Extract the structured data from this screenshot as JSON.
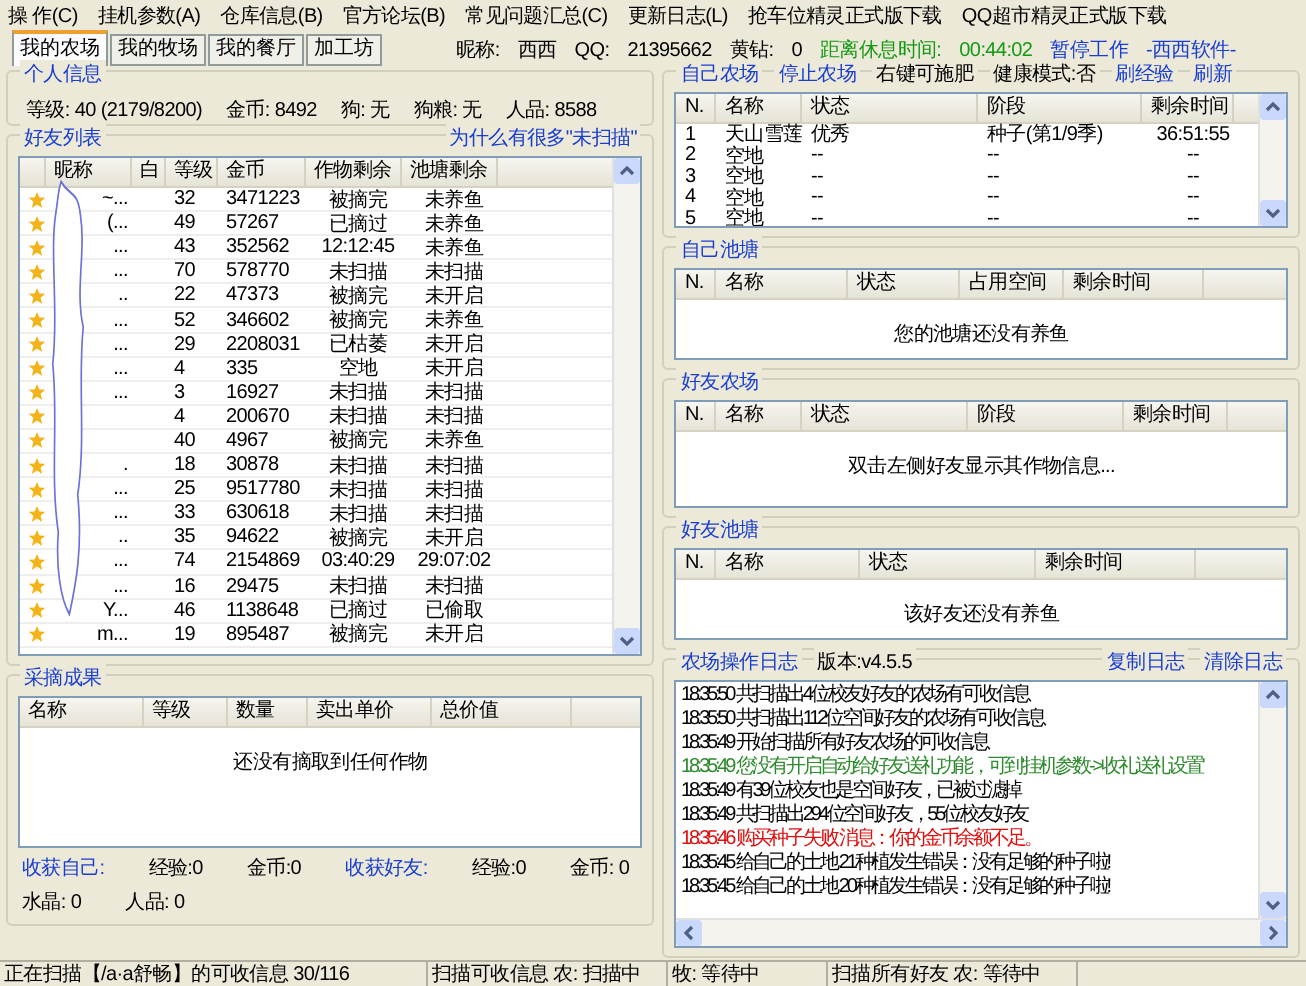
{
  "menu": [
    "操 作(C)",
    "挂机参数(A)",
    "仓库信息(B)",
    "官方论坛(B)",
    "常见问题汇总(C)",
    "更新日志(L)",
    "抢车位精灵正式版下载",
    "QQ超市精灵正式版下载"
  ],
  "tabs": [
    {
      "label": "我的农场",
      "selected": true
    },
    {
      "label": "我的牧场",
      "selected": false
    },
    {
      "label": "我的餐厅",
      "selected": false
    },
    {
      "label": "加工坊",
      "selected": false
    }
  ],
  "header": {
    "nickname_label": "昵称:",
    "nickname": "西西",
    "qq_label": "QQ:",
    "qq": "21395662",
    "diamond_label": "黄钻:",
    "diamond": "0",
    "rest_label": "距离休息时间:",
    "rest_time": "00:44:02",
    "pause": "暂停工作",
    "brand": "-西西软件-"
  },
  "personal": {
    "title": "个人信息",
    "fields": [
      {
        "label": "等级:",
        "value": "40 (2179/8200)"
      },
      {
        "label": "金币:",
        "value": "8492"
      },
      {
        "label": "狗:",
        "value": "无"
      },
      {
        "label": "狗粮:",
        "value": "无"
      },
      {
        "label": "人品:",
        "value": "8588"
      }
    ]
  },
  "friends": {
    "title": "好友列表",
    "link": "为什么有很多\"未扫描\"",
    "columns": [
      "昵称",
      "白",
      "等级",
      "金币",
      "作物剩余",
      "池塘剩余"
    ],
    "rows": [
      {
        "name": "~...",
        "level": "32",
        "gold": "3471223",
        "crop": "被摘完",
        "pond": "未养鱼"
      },
      {
        "name": "(...",
        "level": "49",
        "gold": "57267",
        "crop": "已摘过",
        "pond": "未养鱼"
      },
      {
        "name": "...",
        "level": "43",
        "gold": "352562",
        "crop": "12:12:45",
        "pond": "未养鱼"
      },
      {
        "name": "...",
        "level": "70",
        "gold": "578770",
        "crop": "未扫描",
        "pond": "未扫描"
      },
      {
        "name": "..",
        "level": "22",
        "gold": "47373",
        "crop": "被摘完",
        "pond": "未开启"
      },
      {
        "name": "...",
        "level": "52",
        "gold": "346602",
        "crop": "被摘完",
        "pond": "未养鱼"
      },
      {
        "name": "...",
        "level": "29",
        "gold": "2208031",
        "crop": "已枯萎",
        "pond": "未开启"
      },
      {
        "name": "...",
        "level": "4",
        "gold": "335",
        "crop": "空地",
        "pond": "未开启"
      },
      {
        "name": "...",
        "level": "3",
        "gold": "16927",
        "crop": "未扫描",
        "pond": "未扫描"
      },
      {
        "name": "",
        "level": "4",
        "gold": "200670",
        "crop": "未扫描",
        "pond": "未扫描"
      },
      {
        "name": "",
        "level": "40",
        "gold": "4967",
        "crop": "被摘完",
        "pond": "未养鱼"
      },
      {
        "name": ".",
        "level": "18",
        "gold": "30878",
        "crop": "未扫描",
        "pond": "未扫描"
      },
      {
        "name": "...",
        "level": "25",
        "gold": "9517780",
        "crop": "未扫描",
        "pond": "未扫描"
      },
      {
        "name": "...",
        "level": "33",
        "gold": "630618",
        "crop": "未扫描",
        "pond": "未扫描"
      },
      {
        "name": "..",
        "level": "35",
        "gold": "94622",
        "crop": "被摘完",
        "pond": "未开启"
      },
      {
        "name": "...",
        "level": "74",
        "gold": "2154869",
        "crop": "03:40:29",
        "pond": "29:07:02"
      },
      {
        "name": "...",
        "level": "16",
        "gold": "29475",
        "crop": "未扫描",
        "pond": "未扫描"
      },
      {
        "name": "Y...",
        "level": "46",
        "gold": "1138648",
        "crop": "已摘过",
        "pond": "已偷取"
      },
      {
        "name": "m...",
        "level": "19",
        "gold": "895487",
        "crop": "被摘完",
        "pond": "未开启"
      }
    ]
  },
  "harvest": {
    "title": "采摘成果",
    "columns": [
      "名称",
      "等级",
      "数量",
      "卖出单价",
      "总价值"
    ],
    "empty": "还没有摘取到任何作物",
    "summary": [
      [
        {
          "kind": "link",
          "text": "收获自己:"
        },
        {
          "kind": "text",
          "text": "经验:0"
        },
        {
          "kind": "text",
          "text": "金币:0"
        },
        {
          "kind": "link",
          "text": "收获好友:"
        },
        {
          "kind": "text",
          "text": "经验:0"
        },
        {
          "kind": "text",
          "text": "金币: 0"
        }
      ],
      [
        {
          "kind": "text",
          "text": "水晶: 0"
        },
        {
          "kind": "text",
          "text": "人品: 0"
        }
      ]
    ]
  },
  "own_farm": {
    "title": "自己农场",
    "actions": [
      {
        "kind": "link",
        "text": "停止农场"
      },
      {
        "kind": "text",
        "text": "右键可施肥"
      },
      {
        "kind": "text",
        "text": "健康模式:否"
      },
      {
        "kind": "link",
        "text": "刷经验"
      },
      {
        "kind": "link",
        "text": "刷新"
      }
    ],
    "columns": [
      "N.",
      "名称",
      "状态",
      "阶段",
      "剩余时间"
    ],
    "rows": [
      [
        "1",
        "天山雪莲",
        "优秀",
        "种子(第1/9季)",
        "36:51:55"
      ],
      [
        "2",
        "空地",
        "--",
        "--",
        "--"
      ],
      [
        "3",
        "空地",
        "--",
        "--",
        "--"
      ],
      [
        "4",
        "空地",
        "--",
        "--",
        "--"
      ],
      [
        "5",
        "空地",
        "--",
        "--",
        "--"
      ]
    ]
  },
  "own_pond": {
    "title": "自己池塘",
    "columns": [
      "N.",
      "名称",
      "状态",
      "占用空间",
      "剩余时间"
    ],
    "empty": "您的池塘还没有养鱼"
  },
  "friend_farm": {
    "title": "好友农场",
    "columns": [
      "N.",
      "名称",
      "状态",
      "阶段",
      "剩余时间"
    ],
    "empty": "双击左侧好友显示其作物信息..."
  },
  "friend_pond": {
    "title": "好友池塘",
    "columns": [
      "N.",
      "名称",
      "状态",
      "剩余时间"
    ],
    "empty": "该好友还没有养鱼"
  },
  "log": {
    "title": "农场操作日志",
    "version": "版本:v4.5.5",
    "actions": [
      "复制日志",
      "清除日志"
    ],
    "lines": [
      {
        "text": "18:35:50 共扫描出4位校友好友的农场有可收信息",
        "color": "#000000"
      },
      {
        "text": "18:35:50 共扫描出112位空间好友的农场有可收信息",
        "color": "#000000"
      },
      {
        "text": "18:35:49 开始扫描所有好友农场的可收信息",
        "color": "#000000"
      },
      {
        "text": "18:35:49 您没有开启自动给好友送礼功能，可到'挂机参数->收礼送礼设置'",
        "color": "#2e8b2e"
      },
      {
        "text": "18:35:49 有39位校友也是空间好友，已被过滤掉",
        "color": "#000000"
      },
      {
        "text": "18:35:49 共扫描出294位空间好友，55位校友好友",
        "color": "#000000"
      },
      {
        "text": "18:35:46 购买种子失败 消息：你的金币余额不足。",
        "color": "#e01010"
      },
      {
        "text": "18:35:45 给自己的土地 21种植发生错误：没有足够的种子啦!",
        "color": "#000000"
      },
      {
        "text": "18:35:45 给自己的土地 20种植发生错误：没有足够的种子啦!",
        "color": "#000000"
      }
    ]
  },
  "status": [
    "正在扫描【/a·a舒畅】的可收信息 30/116",
    "扫描可收信息 农: 扫描中",
    "牧: 等待中",
    "扫描所有好友 农: 等待中"
  ]
}
